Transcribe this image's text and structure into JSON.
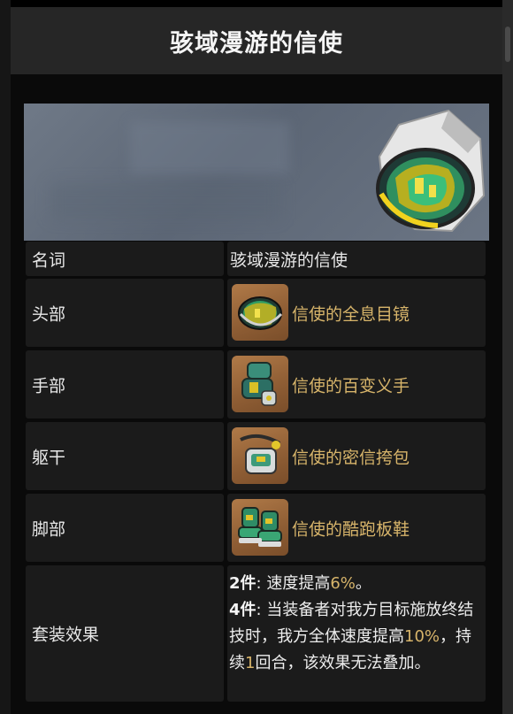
{
  "page": {
    "title": "骇域漫游的信使"
  },
  "table": {
    "name_label": "名词",
    "name_value": "骇域漫游的信使",
    "slots": [
      {
        "label": "头部",
        "item": "信使的全息目镜",
        "icon": "goggles-icon"
      },
      {
        "label": "手部",
        "item": "信使的百变义手",
        "icon": "gauntlet-icon"
      },
      {
        "label": "躯干",
        "item": "信使的密信挎包",
        "icon": "satchel-icon"
      },
      {
        "label": "脚部",
        "item": "信使的酷跑板鞋",
        "icon": "sneakers-icon"
      }
    ],
    "effect_label": "套装效果",
    "effect": {
      "two_piece_label": "2件",
      "two_piece_text": ": 速度提高",
      "two_piece_value": "6%",
      "two_piece_end": "。",
      "four_piece_label": "4件",
      "four_piece_text": ": 当装备者对我方目标施放终结技时，我方全体速度提高",
      "four_piece_value": "10%",
      "four_piece_mid": "，持续",
      "four_piece_turns": "1",
      "four_piece_end": "回合，该效果无法叠加。"
    }
  },
  "colors": {
    "accent_gold": "#d7b46a",
    "header_bg": "#262626",
    "cell_bg": "#1b1b1b"
  }
}
